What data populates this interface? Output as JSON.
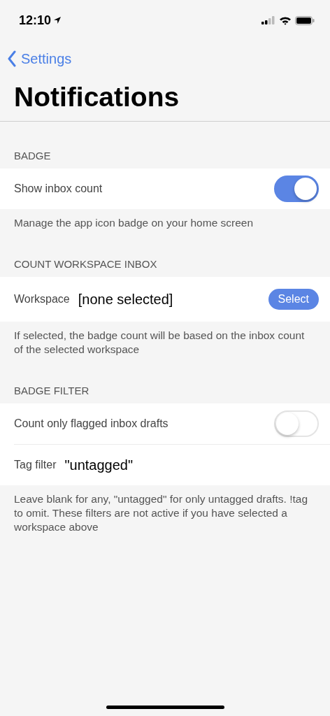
{
  "status_bar": {
    "time": "12:10"
  },
  "nav": {
    "back_label": "Settings",
    "title": "Notifications"
  },
  "sections": [
    {
      "header": "BADGE",
      "rows": [
        {
          "kind": "toggle",
          "label": "Show inbox count",
          "on": true
        }
      ],
      "footer": "Manage the app icon badge on your home screen"
    },
    {
      "header": "COUNT WORKSPACE INBOX",
      "rows": [
        {
          "kind": "select",
          "label": "Workspace",
          "value": "[none selected]",
          "button": "Select"
        }
      ],
      "footer": "If selected, the badge count will be based on the inbox count of the selected workspace"
    },
    {
      "header": "BADGE FILTER",
      "rows": [
        {
          "kind": "toggle",
          "label": "Count only flagged inbox drafts",
          "on": false
        },
        {
          "kind": "text",
          "label": "Tag filter",
          "value": "\"untagged\""
        }
      ],
      "footer": "Leave blank for any, \"untagged\" for only untagged drafts. !tag to omit. These filters are not active if you have selected a workspace above"
    }
  ]
}
